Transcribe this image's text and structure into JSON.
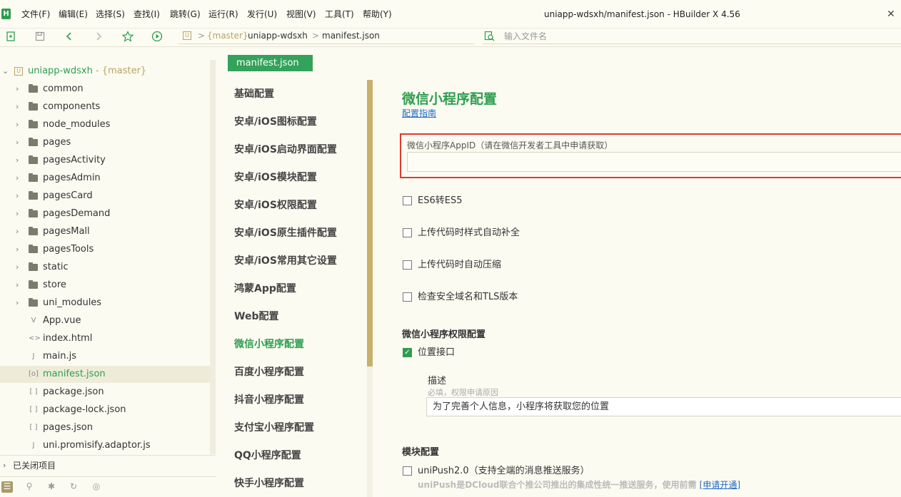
{
  "menubar": {
    "logo": "H",
    "items": [
      "文件(F)",
      "编辑(E)",
      "选择(S)",
      "查找(I)",
      "跳转(G)",
      "运行(R)",
      "发行(U)",
      "视图(V)",
      "工具(T)",
      "帮助(Y)"
    ],
    "window_title": "uniapp-wdsxh/manifest.json - HBuilder X 4.56",
    "close": "✕"
  },
  "toolbar": {
    "breadcrumb": {
      "branch": "{master}",
      "project": "uniapp-wdsxh",
      "file": "manifest.json",
      "separator": ">"
    },
    "file_search_placeholder": "输入文件名"
  },
  "sidebar": {
    "project": {
      "name": "uniapp-wdsxh",
      "branch": " - {master}"
    },
    "items": [
      {
        "label": "common",
        "type": "folder"
      },
      {
        "label": "components",
        "type": "folder"
      },
      {
        "label": "node_modules",
        "type": "folder"
      },
      {
        "label": "pages",
        "type": "folder"
      },
      {
        "label": "pagesActivity",
        "type": "folder"
      },
      {
        "label": "pagesAdmin",
        "type": "folder"
      },
      {
        "label": "pagesCard",
        "type": "folder"
      },
      {
        "label": "pagesDemand",
        "type": "folder"
      },
      {
        "label": "pagesMall",
        "type": "folder"
      },
      {
        "label": "pagesTools",
        "type": "folder"
      },
      {
        "label": "static",
        "type": "folder"
      },
      {
        "label": "store",
        "type": "folder"
      },
      {
        "label": "uni_modules",
        "type": "folder"
      },
      {
        "label": "App.vue",
        "type": "vue-file",
        "icon": "V"
      },
      {
        "label": "index.html",
        "type": "html-file",
        "icon": "<>"
      },
      {
        "label": "main.js",
        "type": "js-file",
        "icon": "J"
      },
      {
        "label": "manifest.json",
        "type": "manifest-file",
        "icon": "[o]",
        "selected": true
      },
      {
        "label": "package.json",
        "type": "json-file",
        "icon": "[ ]"
      },
      {
        "label": "package-lock.json",
        "type": "json-file",
        "icon": "[ ]"
      },
      {
        "label": "pages.json",
        "type": "json-file",
        "icon": "[ ]"
      },
      {
        "label": "uni.promisify.adaptor.js",
        "type": "js-file",
        "icon": "J"
      }
    ],
    "closed_projects": "已关闭项目"
  },
  "editor": {
    "tab": "manifest.json"
  },
  "config_nav": {
    "items": [
      "基础配置",
      "安卓/iOS图标配置",
      "安卓/iOS启动界面配置",
      "安卓/iOS模块配置",
      "安卓/iOS权限配置",
      "安卓/iOS原生插件配置",
      "安卓/iOS常用其它设置",
      "鸿蒙App配置",
      "Web配置",
      "微信小程序配置",
      "百度小程序配置",
      "抖音小程序配置",
      "支付宝小程序配置",
      "QQ小程序配置",
      "快手小程序配置"
    ],
    "active_index": 9
  },
  "main": {
    "title": "微信小程序配置",
    "guide_link": "配置指南",
    "appid_label": "微信小程序AppID（请在微信开发者工具中申请获取）",
    "appid_value": "",
    "options": [
      {
        "label": "ES6转ES5",
        "checked": false
      },
      {
        "label": "上传代码时样式自动补全",
        "checked": false
      },
      {
        "label": "上传代码时自动压缩",
        "checked": false
      },
      {
        "label": "检查安全域名和TLS版本",
        "checked": false
      }
    ],
    "permission_title": "微信小程序权限配置",
    "location_label": "位置接口",
    "location_checked": true,
    "desc_label": "描述",
    "desc_hint": "必填，权限申请原因",
    "desc_value": "为了完善个人信息，小程序将获取您的位置",
    "module_title": "模块配置",
    "push_label": "uniPush2.0（支持全端的消息推送服务）",
    "push_checked": false,
    "push_desc": "uniPush是DCloud联合个推公司推出的集成性统一推送服务，使用前需",
    "push_link": "[申请开通]"
  },
  "colors": {
    "accent": "#2e9e4f",
    "highlight_border": "#dd3b2e",
    "link": "#2168c4",
    "background": "#fcfbf2"
  }
}
